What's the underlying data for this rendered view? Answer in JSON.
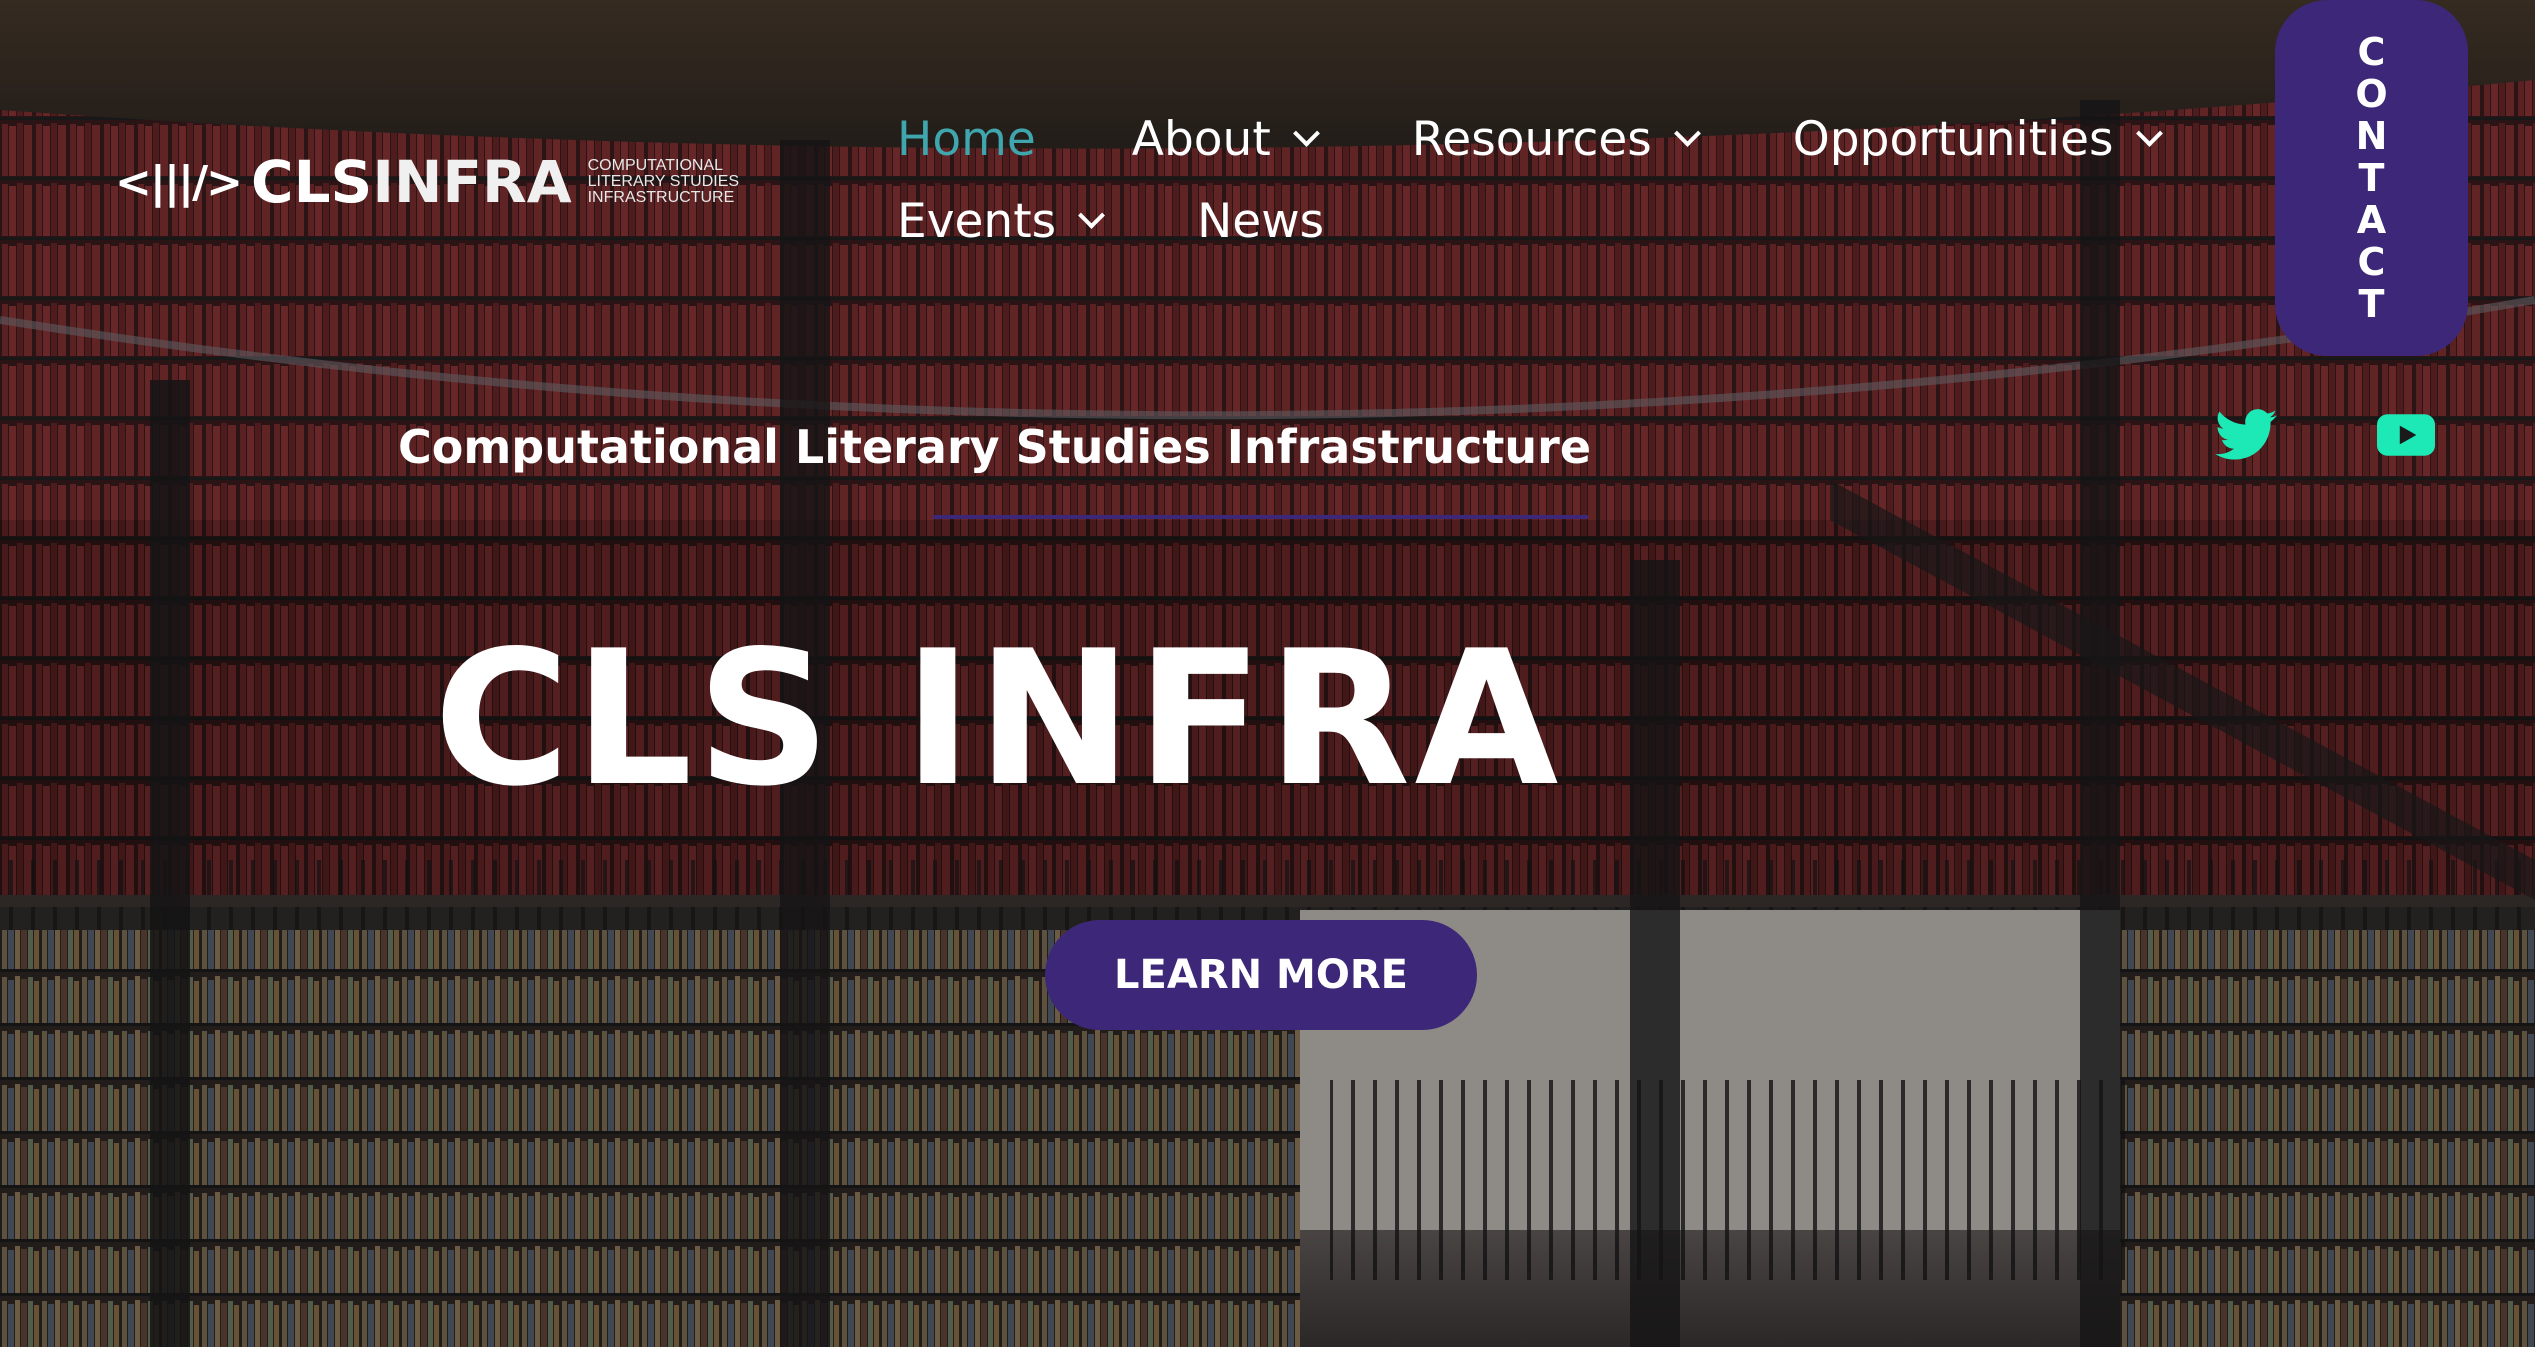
{
  "logo": {
    "mark": "<|||/>",
    "word_cls": "CLS",
    "word_infra": "INFRA",
    "sub_lines": [
      "COMPUTATIONAL",
      "LITERARY STUDIES",
      "INFRASTRUCTURE"
    ]
  },
  "nav": {
    "row1": [
      {
        "label": "Home",
        "active": true,
        "has_dropdown": false
      },
      {
        "label": "About",
        "active": false,
        "has_dropdown": true
      },
      {
        "label": "Resources",
        "active": false,
        "has_dropdown": true
      },
      {
        "label": "Opportunities",
        "active": false,
        "has_dropdown": true
      }
    ],
    "row2": [
      {
        "label": "Events",
        "active": false,
        "has_dropdown": true
      },
      {
        "label": "News",
        "active": false,
        "has_dropdown": false
      }
    ]
  },
  "contact": {
    "label": "CONTACT",
    "letters": [
      "C",
      "O",
      "N",
      "T",
      "A",
      "C",
      "T"
    ]
  },
  "social": {
    "twitter_icon": "twitter-icon",
    "youtube_icon": "youtube-icon"
  },
  "hero": {
    "tagline": "Computational Literary Studies Infrastructure",
    "headline": "CLS INFRA",
    "cta_label": "LEARN MORE"
  },
  "colors": {
    "accent_purple": "#3d2778",
    "active_link": "#3fa6ad",
    "social_teal": "#1de9b6",
    "text": "#ffffff"
  }
}
